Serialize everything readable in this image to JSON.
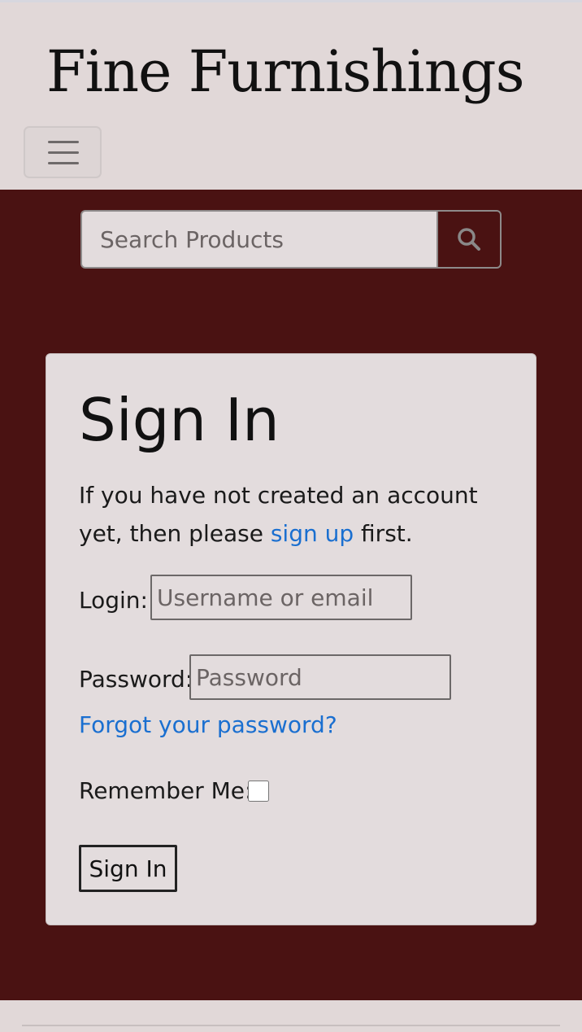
{
  "header": {
    "brand": "Fine Furnishings",
    "menu_icon": "hamburger-menu-icon"
  },
  "search": {
    "placeholder": "Search Products",
    "icon": "search-icon"
  },
  "signin": {
    "title": "Sign In",
    "intro_before": "If you have not created an account yet, then please ",
    "signup_link": "sign up",
    "intro_after": " first.",
    "login_label": "Login:",
    "login_placeholder": "Username or email",
    "password_label": "Password:",
    "password_placeholder": "Password",
    "forgot_link": "Forgot your password?",
    "remember_label": "Remember Me:",
    "submit_label": "Sign In"
  },
  "colors": {
    "header_bg": "#e1d8d8",
    "main_bg": "#4a1212",
    "card_bg": "#e3dcdd",
    "link": "#1a6fd0"
  }
}
